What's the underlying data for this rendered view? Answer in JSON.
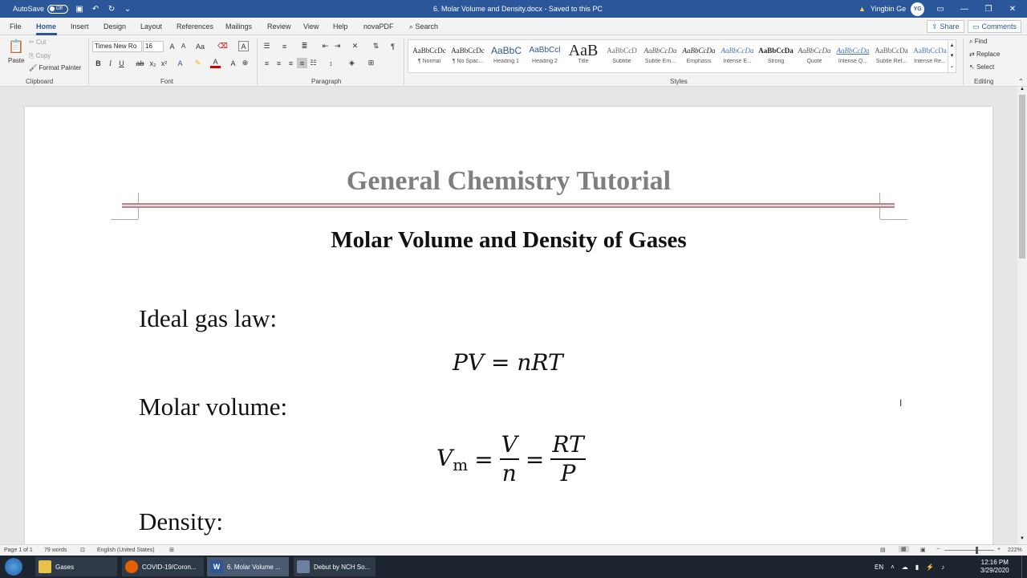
{
  "titlebar": {
    "autosave_label": "AutoSave",
    "autosave_state": "Off",
    "doc_title": "6. Molar Volume and Density.docx  -  Saved to this PC",
    "user_name": "Yingbin Ge",
    "user_initials": "YG",
    "bg_color": "#2b579a"
  },
  "tabs": [
    "File",
    "Home",
    "Insert",
    "Design",
    "Layout",
    "References",
    "Mailings",
    "Review",
    "View",
    "Help",
    "novaPDF"
  ],
  "active_tab": "Home",
  "search_label": "Search",
  "share_label": "Share",
  "comments_label": "Comments",
  "clipboard": {
    "paste": "Paste",
    "cut": "Cut",
    "copy": "Copy",
    "format_painter": "Format Painter",
    "group": "Clipboard"
  },
  "font": {
    "name": "Times New Ro",
    "size": "16",
    "group": "Font"
  },
  "paragraph_group": "Paragraph",
  "styles": {
    "group": "Styles",
    "items": [
      {
        "preview": "AaBbCcDc",
        "name": "¶ Normal"
      },
      {
        "preview": "AaBbCcDc",
        "name": "¶ No Spac..."
      },
      {
        "preview": "AaBbC",
        "name": "Heading 1"
      },
      {
        "preview": "AaBbCcl",
        "name": "Heading 2"
      },
      {
        "preview": "AaB",
        "name": "Title"
      },
      {
        "preview": "AaBbCcD",
        "name": "Subtitle"
      },
      {
        "preview": "AaBbCcDa",
        "name": "Subtle Em..."
      },
      {
        "preview": "AaBbCcDa",
        "name": "Emphasis"
      },
      {
        "preview": "AaBbCcDa",
        "name": "Intense E..."
      },
      {
        "preview": "AaBbCcDa",
        "name": "Strong"
      },
      {
        "preview": "AaBbCcDa",
        "name": "Quote"
      },
      {
        "preview": "AaBbCcDa",
        "name": "Intense Q..."
      },
      {
        "preview": "AaBbCcDa",
        "name": "Subtle Ref..."
      },
      {
        "preview": "AaBbCcDa",
        "name": "Intense Re..."
      }
    ]
  },
  "editing": {
    "find": "Find",
    "replace": "Replace",
    "select": "Select",
    "group": "Editing"
  },
  "document": {
    "header_title": "General Chemistry Tutorial",
    "heading": "Molar Volume and Density of Gases",
    "label_ideal": "Ideal gas law:",
    "eq_ideal": "PV = nRT",
    "label_molar": "Molar volume:",
    "eq_vm": "V",
    "eq_vm_sub": "m",
    "eq_eq": "=",
    "eq_v": "V",
    "eq_n": "n",
    "eq_rt": "RT",
    "eq_p": "P",
    "label_density": "Density:"
  },
  "status": {
    "page": "Page 1 of 1",
    "words": "79 words",
    "language": "English (United States)",
    "zoom": "222%"
  },
  "taskbar": {
    "items": [
      "Gases",
      "COVID-19/Coron...",
      "6. Molar Volume ...",
      "Debut by NCH So..."
    ],
    "lang": "EN",
    "time": "12:16 PM",
    "date": "3/29/2020"
  }
}
